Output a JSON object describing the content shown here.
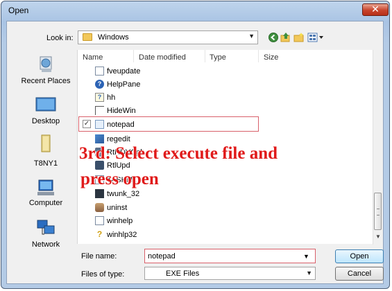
{
  "window": {
    "title": "Open",
    "close_glyph": "✕"
  },
  "lookin": {
    "label": "Look in:",
    "value": "Windows",
    "icon": "folder-icon"
  },
  "toolbar": {
    "icons": [
      "back-icon",
      "up-folder-icon",
      "new-folder-icon",
      "views-menu-icon"
    ]
  },
  "places": [
    {
      "label": "Recent Places",
      "icon": "recent-places-icon"
    },
    {
      "label": "Desktop",
      "icon": "desktop-icon"
    },
    {
      "label": "T8NY1",
      "icon": "user-folder-icon"
    },
    {
      "label": "Computer",
      "icon": "computer-icon"
    },
    {
      "label": "Network",
      "icon": "network-icon"
    }
  ],
  "columns": [
    "Name",
    "Date modified",
    "Type",
    "Size"
  ],
  "files": [
    {
      "name": "fveupdate",
      "icon": "exe-window-icon"
    },
    {
      "name": "HelpPane",
      "icon": "help-icon"
    },
    {
      "name": "hh",
      "icon": "help-doc-icon"
    },
    {
      "name": "HideWin",
      "icon": "window-icon"
    },
    {
      "name": "notepad",
      "icon": "notepad-icon",
      "selected": true
    },
    {
      "name": "regedit",
      "icon": "regedit-icon"
    },
    {
      "name": "RtHDVCpl",
      "icon": "audio-icon"
    },
    {
      "name": "RtlUpd",
      "icon": "update-icon"
    },
    {
      "name": "TASKM...",
      "icon": "exe-window-icon"
    },
    {
      "name": "twunk_32",
      "icon": "scanner-icon"
    },
    {
      "name": "uninst",
      "icon": "uninstall-icon"
    },
    {
      "name": "winhelp",
      "icon": "exe-window-icon"
    },
    {
      "name": "winhlp32",
      "icon": "help-question-icon"
    }
  ],
  "annotation": {
    "line1": "3rd: Select execute file and",
    "line2": "press open",
    "color": "#e01a1a"
  },
  "filename": {
    "label": "File name:",
    "value": "notepad"
  },
  "filetype": {
    "label": "Files of type:",
    "value": "EXE Files"
  },
  "buttons": {
    "open": "Open",
    "cancel": "Cancel"
  }
}
